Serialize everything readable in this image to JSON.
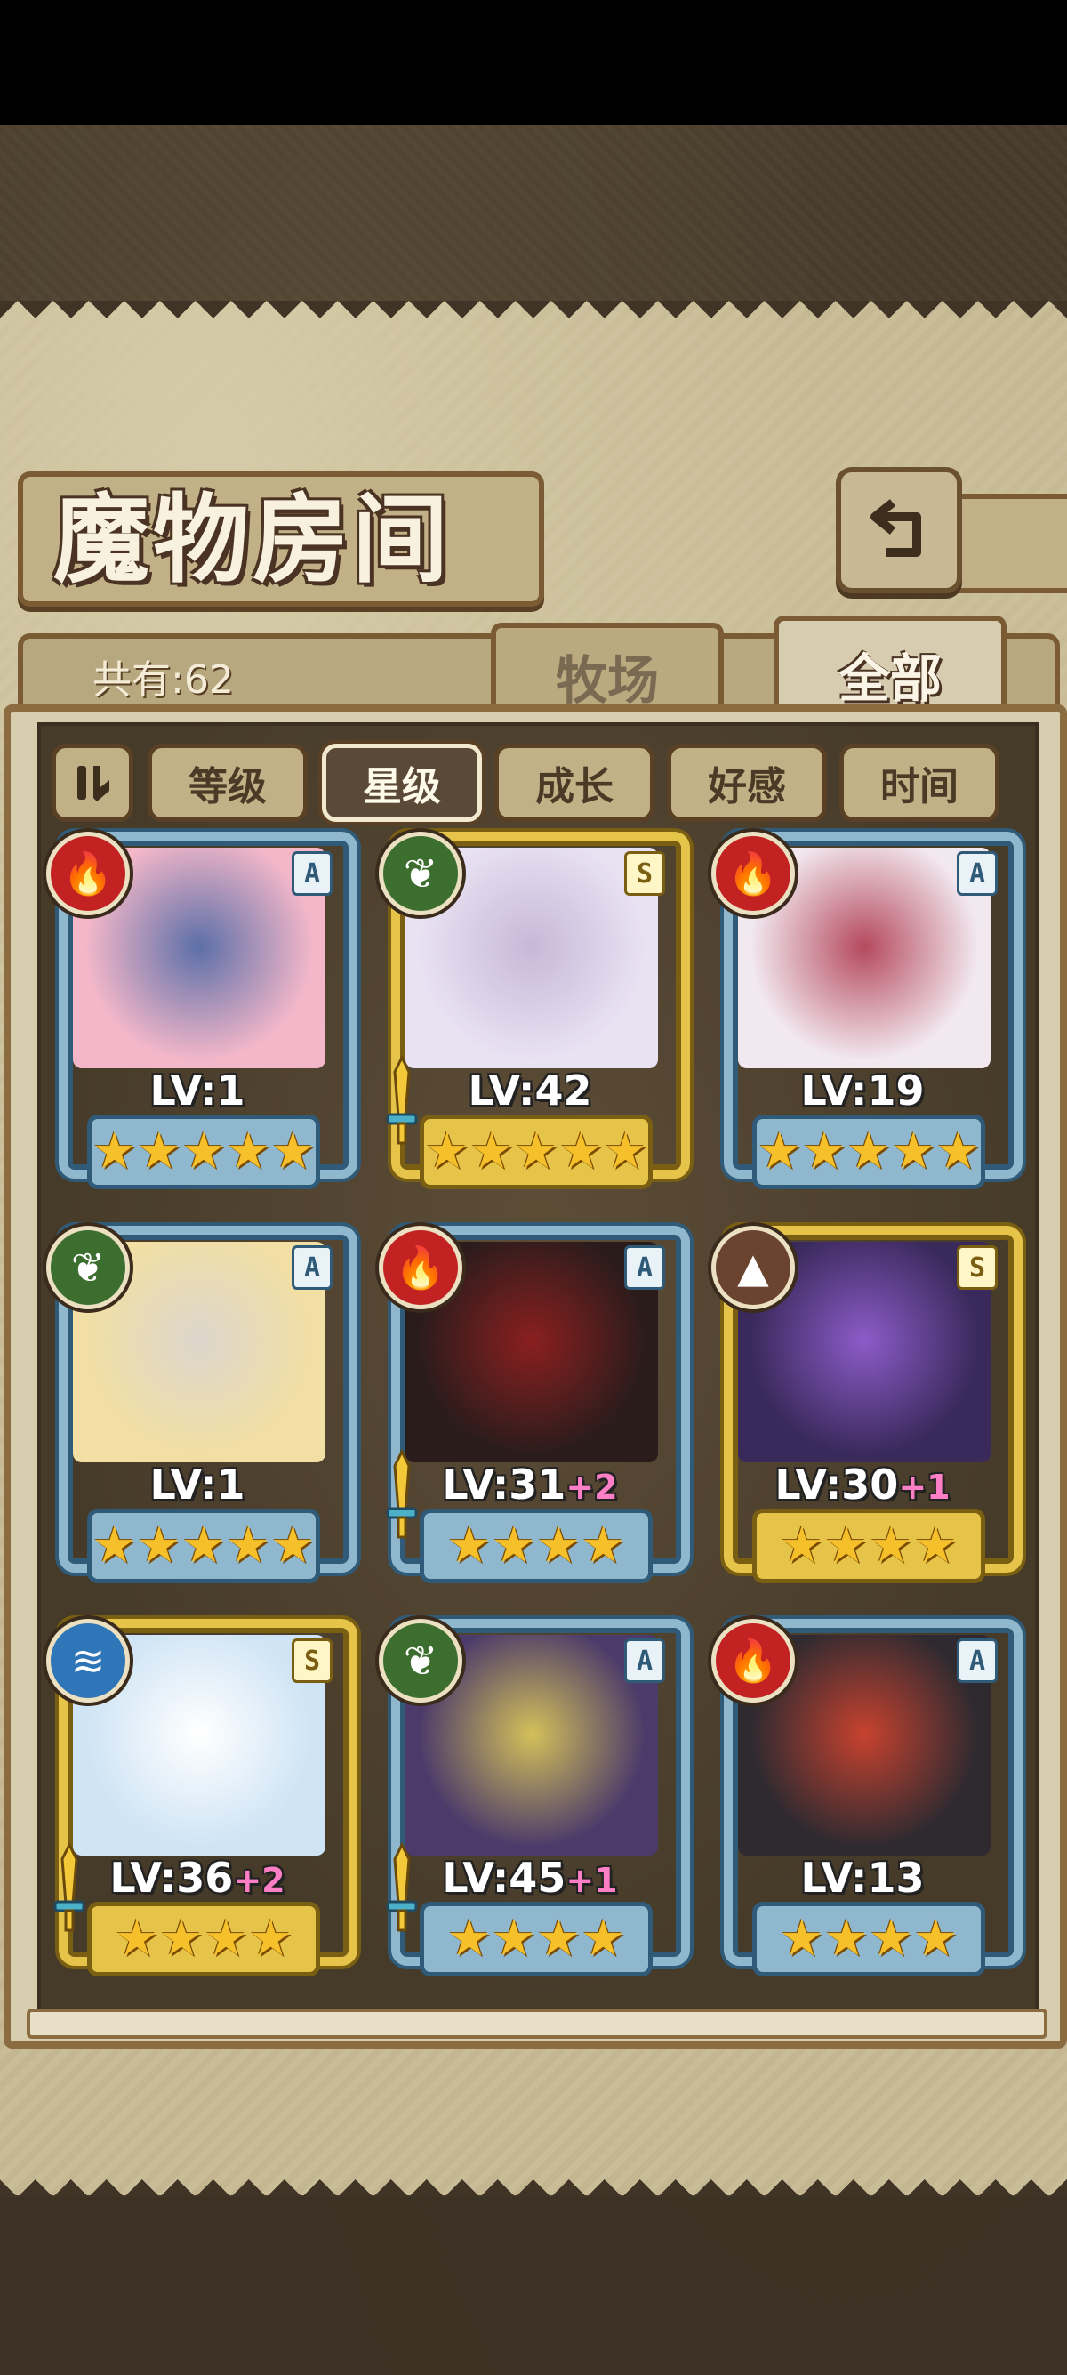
{
  "screen": {
    "title": "魔物房间",
    "count_label": "共有:62",
    "back_icon": "return-arrow-icon",
    "tabs": [
      {
        "label": "牧场",
        "active": false
      },
      {
        "label": "全部",
        "active": true
      }
    ],
    "sort_toggle_icon": "pause-sort-icon",
    "sort_buttons": [
      {
        "label": "等级",
        "active": false
      },
      {
        "label": "星级",
        "active": true
      },
      {
        "label": "成长",
        "active": false
      },
      {
        "label": "好感",
        "active": false
      },
      {
        "label": "时间",
        "active": false
      }
    ]
  },
  "monsters": [
    {
      "attr": "fire",
      "attr_icon": "flame-icon",
      "rank": "A",
      "lv": "LV:1",
      "plus": "",
      "stars": 5,
      "frame": "silver",
      "sword": false
    },
    {
      "attr": "leaf",
      "attr_icon": "leaf-icon",
      "rank": "S",
      "lv": "LV:42",
      "plus": "",
      "stars": 5,
      "frame": "gold",
      "sword": true
    },
    {
      "attr": "fire",
      "attr_icon": "flame-icon",
      "rank": "A",
      "lv": "LV:19",
      "plus": "",
      "stars": 5,
      "frame": "silver",
      "sword": false
    },
    {
      "attr": "leaf",
      "attr_icon": "leaf-icon",
      "rank": "A",
      "lv": "LV:1",
      "plus": "",
      "stars": 5,
      "frame": "silver",
      "sword": false
    },
    {
      "attr": "fire",
      "attr_icon": "flame-icon",
      "rank": "A",
      "lv": "LV:31",
      "plus": "+2",
      "stars": 4,
      "frame": "silver",
      "sword": true
    },
    {
      "attr": "earth",
      "attr_icon": "mountain-icon",
      "rank": "S",
      "lv": "LV:30",
      "plus": "+1",
      "stars": 4,
      "frame": "gold",
      "sword": false
    },
    {
      "attr": "water",
      "attr_icon": "wave-icon",
      "rank": "S",
      "lv": "LV:36",
      "plus": "+2",
      "stars": 4,
      "frame": "gold",
      "sword": true
    },
    {
      "attr": "leaf",
      "attr_icon": "leaf-icon",
      "rank": "A",
      "lv": "LV:45",
      "plus": "+1",
      "stars": 4,
      "frame": "silver",
      "sword": true
    },
    {
      "attr": "fire",
      "attr_icon": "flame-icon",
      "rank": "A",
      "lv": "LV:13",
      "plus": "",
      "stars": 4,
      "frame": "silver",
      "sword": false
    }
  ]
}
